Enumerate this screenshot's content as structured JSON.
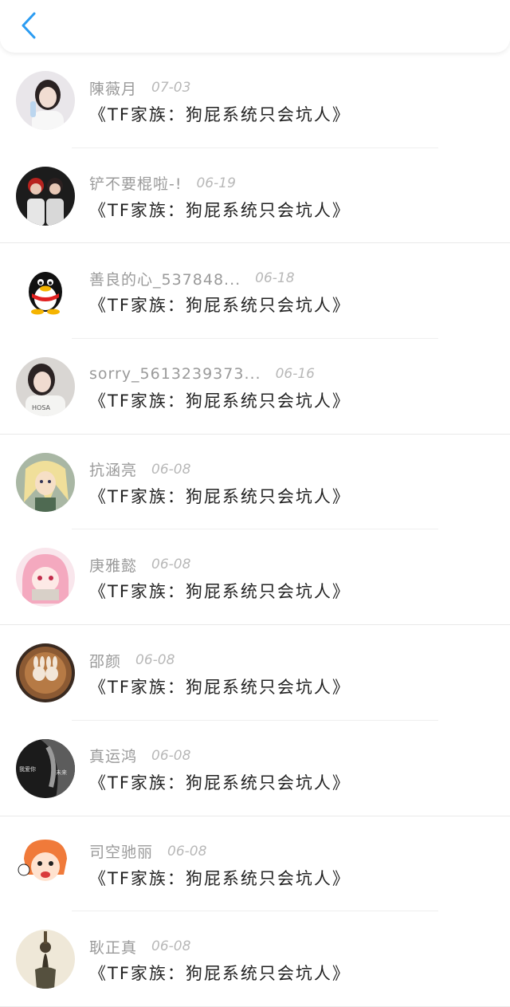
{
  "header": {
    "back_icon": "chevron-left-icon",
    "accent": "#2b9cf2"
  },
  "items": [
    {
      "name": "陳薇月",
      "date": "07-03",
      "title": "《TF家族：狗屁系统只会坑人》",
      "avatar": "photo-girl"
    },
    {
      "name": "铲不要棍啦-!",
      "date": "06-19",
      "title": "《TF家族：狗屁系统只会坑人》",
      "avatar": "photo-two-boys"
    },
    {
      "name": "善良的心_537848...",
      "date": "06-18",
      "title": "《TF家族：狗屁系统只会坑人》",
      "avatar": "qq-penguin"
    },
    {
      "name": "sorry_5613239373...",
      "date": "06-16",
      "title": "《TF家族：狗屁系统只会坑人》",
      "avatar": "photo-girl-2"
    },
    {
      "name": "抗涵亮",
      "date": "06-08",
      "title": "《TF家族：狗屁系统只会坑人》",
      "avatar": "anime-blonde"
    },
    {
      "name": "庚雅懿",
      "date": "06-08",
      "title": "《TF家族：狗屁系统只会坑人》",
      "avatar": "anime-pink"
    },
    {
      "name": "邵颜",
      "date": "06-08",
      "title": "《TF家族：狗屁系统只会坑人》",
      "avatar": "latte-art"
    },
    {
      "name": "真运鸿",
      "date": "06-08",
      "title": "《TF家族：狗屁系统只会坑人》",
      "avatar": "dark-photo"
    },
    {
      "name": "司空驰丽",
      "date": "06-08",
      "title": "《TF家族：狗屁系统只会坑人》",
      "avatar": "cartoon-orange"
    },
    {
      "name": "耿正真",
      "date": "06-08",
      "title": "《TF家族：狗屁系统只会坑人》",
      "avatar": "statue-photo"
    }
  ]
}
